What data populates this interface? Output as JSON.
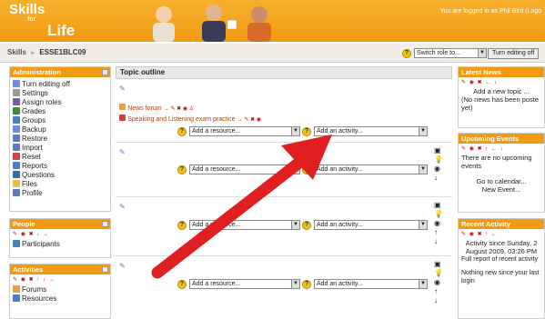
{
  "header": {
    "logo": [
      "Skills",
      "for",
      "Life"
    ],
    "login_text": "You are logged in as Phil Bird (Logo"
  },
  "navbar": {
    "breadcrumb_root": "Skills",
    "breadcrumb_sep": "►",
    "breadcrumb_current": "ESSE1BLC09",
    "switch_role": "Switch role to...",
    "turn_editing": "Turn editing off"
  },
  "admin": {
    "title": "Administration",
    "items": [
      "Turn editing off",
      "Settings",
      "Assign roles",
      "Grades",
      "Groups",
      "Backup",
      "Restore",
      "Import",
      "Reset",
      "Reports",
      "Questions",
      "Files",
      "Profile"
    ]
  },
  "people": {
    "title": "People",
    "items": [
      "Participants"
    ]
  },
  "activities": {
    "title": "Activities",
    "items": [
      "Forums",
      "Resources"
    ]
  },
  "main": {
    "title": "Topic outline",
    "forum_link": "News forum",
    "speaking_link": "Speaking and Listening exam practice",
    "add_resource": "Add a resource...",
    "add_activity": "Add an activity..."
  },
  "latest_news": {
    "title": "Latest News",
    "add_topic": "Add a new topic ...",
    "no_news": "(No news has been poste",
    "no_news2": "yet)"
  },
  "events": {
    "title": "Upcoming Events",
    "none1": "There are no upcoming",
    "none2": "events",
    "calendar": "Go to calendar...",
    "new_event": "New Event..."
  },
  "recent": {
    "title": "Recent Activity",
    "since1": "Activity since Sunday, 2",
    "since2": "August 2009, 03:26 PM",
    "report": "Full report of recent activity",
    "nothing1": "Nothing new since your last",
    "nothing2": "login"
  },
  "colors": {
    "accent": "#f29a12",
    "arrow": "#e02020"
  }
}
